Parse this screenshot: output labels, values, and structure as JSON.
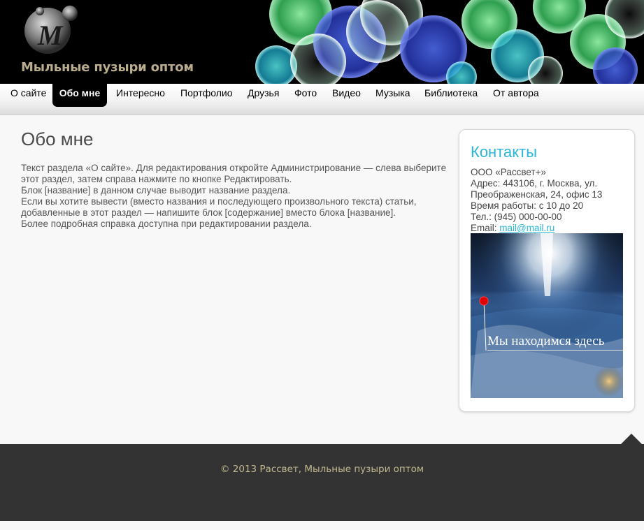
{
  "header": {
    "site_title": "Мыльные пузыри оптом",
    "logo_icon": "bubble-m-logo-icon",
    "background": "#000000"
  },
  "nav": {
    "items": [
      {
        "label": "О сайте",
        "active": false
      },
      {
        "label": "Обо мне",
        "active": true
      },
      {
        "label": "Интересно",
        "active": false
      },
      {
        "label": "Портфолио",
        "active": false
      },
      {
        "label": "Друзья",
        "active": false
      },
      {
        "label": "Фото",
        "active": false
      },
      {
        "label": "Видео",
        "active": false
      },
      {
        "label": "Музыка",
        "active": false
      },
      {
        "label": "Библиотека",
        "active": false
      },
      {
        "label": "От автора",
        "active": false
      }
    ]
  },
  "main": {
    "title": "Обо мне",
    "paragraphs": [
      "Текст раздела «О сайте». Для редактирования откройте Администрирование — слева выберите этот раздел, затем справа нажмите по кнопке Редактировать.",
      "Блок [название] в данном случае выводит название раздела.",
      "Если вы хотите вывести (вместо названия и последующего произвольного текста) статьи, добавленные в этот раздел — напишите блок [содержание] вместо блока [название].",
      "Более подробная справка доступна при редактировании раздела."
    ]
  },
  "contacts": {
    "title": "Контакты",
    "company": "ООО «Рассвет+»",
    "address": "Адрес: 443106, г. Москва, ул. Преображенская, 24, офис 13",
    "hours": "Время работы: с 10 до 20",
    "phone": "Тел.: (945) 000-00-00",
    "email_label": "Email:",
    "email": "mail@mail.ru",
    "map_caption": "Мы находимся здесь",
    "accent_color": "#29b6d8"
  },
  "footer": {
    "copyright": "© 2013 Рассвет, Мыльные пузыри оптом"
  }
}
